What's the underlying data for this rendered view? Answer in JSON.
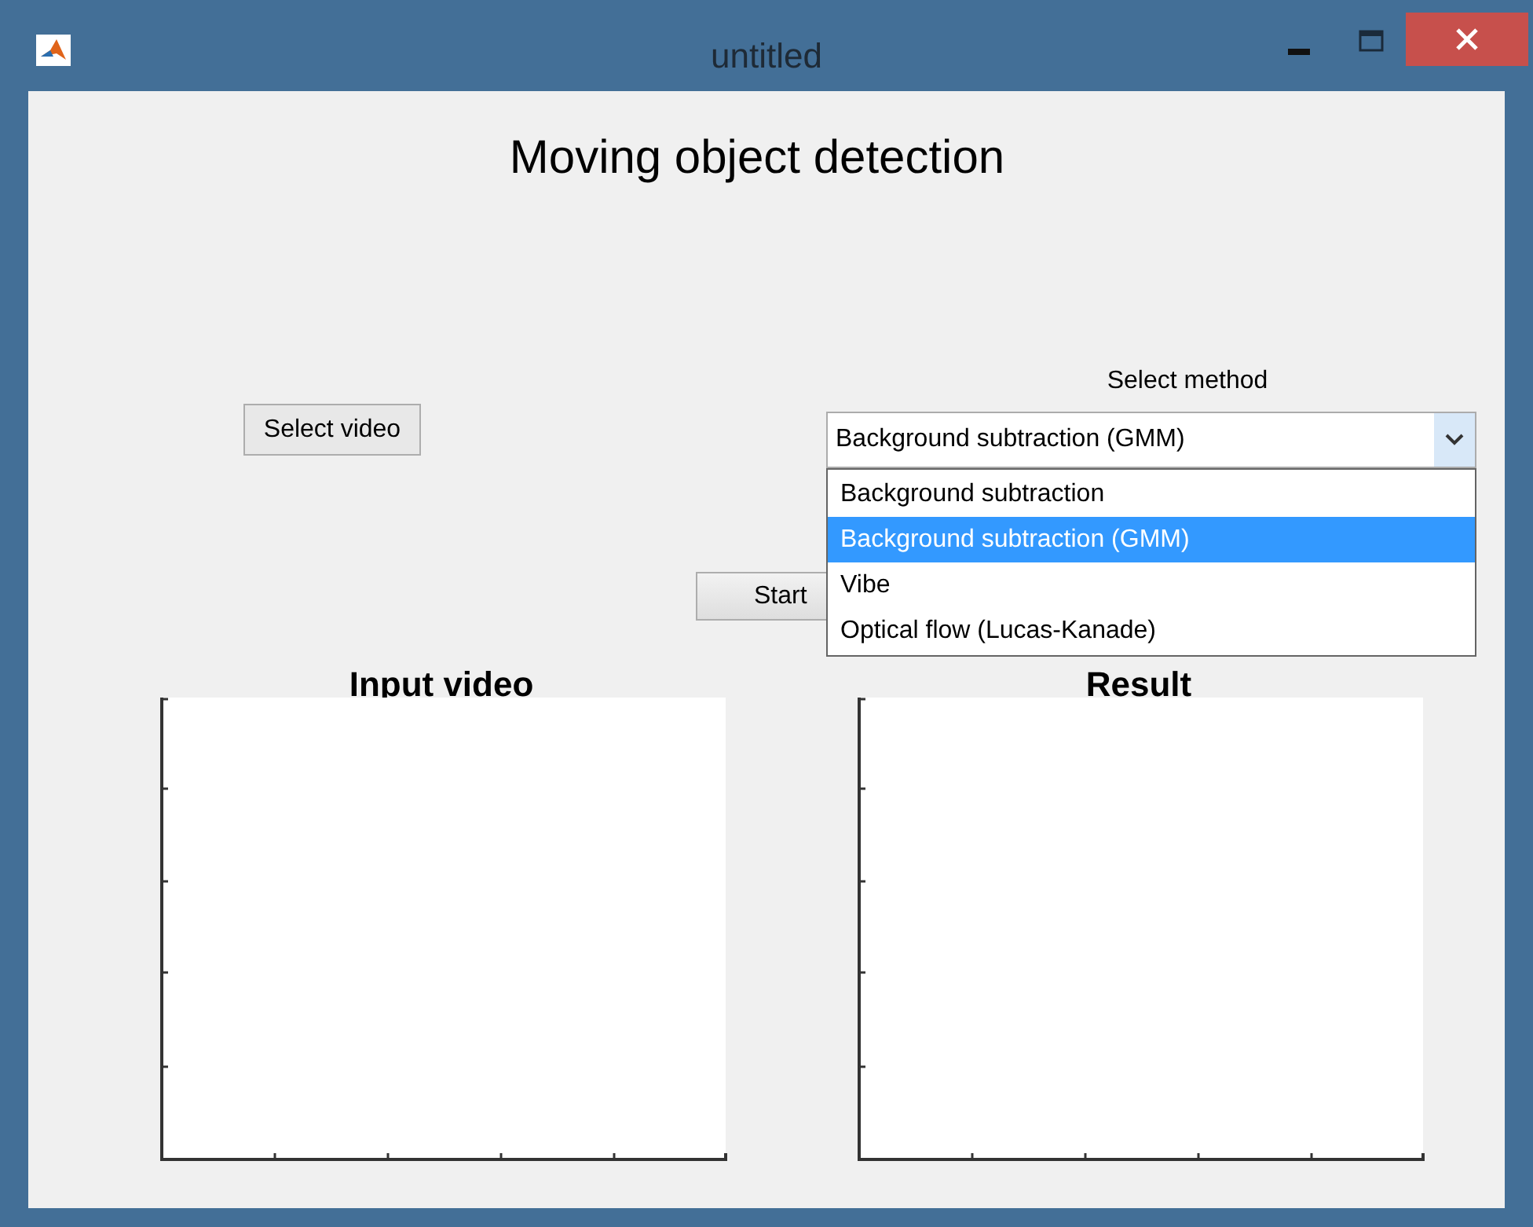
{
  "window": {
    "title": "untitled"
  },
  "heading": "Moving object detection",
  "select_video_button": "Select video",
  "method": {
    "label": "Select method",
    "value": "Background subtraction (GMM)",
    "expanded": true,
    "options": [
      {
        "label": "Background subtraction",
        "selected": false
      },
      {
        "label": "Background subtraction (GMM)",
        "selected": true
      },
      {
        "label": "Vibe",
        "selected": false
      },
      {
        "label": "Optical flow (Lucas-Kanade)",
        "selected": false
      }
    ]
  },
  "start_button": "Start",
  "axes": [
    {
      "title": "Input video"
    },
    {
      "title": "Result"
    }
  ]
}
